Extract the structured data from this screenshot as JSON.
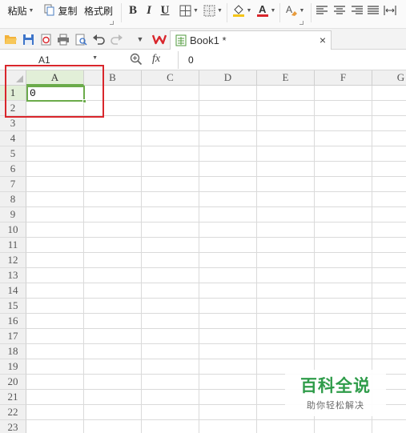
{
  "ribbon": {
    "paste_label": "粘贴",
    "copy_label": "复制",
    "format_painter_label": "格式刷",
    "bold_label": "B",
    "italic_label": "I",
    "underline_label": "U",
    "font_color": "#d9262c",
    "fill_color": "#f5c518"
  },
  "tab": {
    "title": "Book1 *",
    "close_label": "×"
  },
  "formula_bar": {
    "name_box": "A1",
    "fx_label": "fx",
    "value": "0"
  },
  "sheet": {
    "columns": [
      "A",
      "B",
      "C",
      "D",
      "E",
      "F",
      "G"
    ],
    "rows": [
      "1",
      "2",
      "3",
      "4",
      "5",
      "6",
      "7",
      "8",
      "9",
      "10",
      "11",
      "12",
      "13",
      "14",
      "15",
      "16",
      "17",
      "18",
      "19",
      "20",
      "21",
      "22",
      "23"
    ],
    "active_cell": "A1",
    "cell_a1": "0",
    "highlight_color": "#d9262c",
    "selection_color": "#6bab4a"
  },
  "watermark": {
    "title": "百科全说",
    "subtitle": "助你轻松解决"
  }
}
